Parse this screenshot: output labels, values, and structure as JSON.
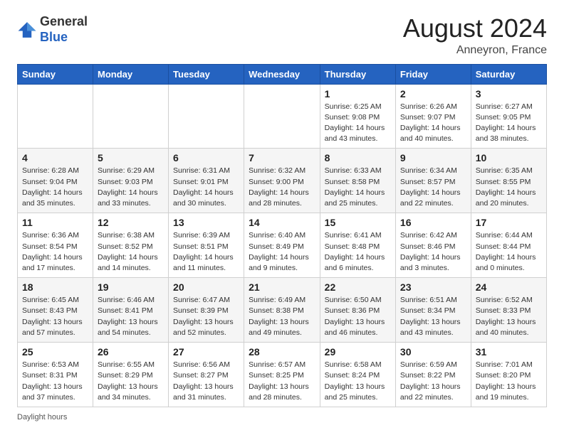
{
  "header": {
    "logo_line1": "General",
    "logo_line2": "Blue",
    "month_title": "August 2024",
    "location": "Anneyron, France"
  },
  "days_of_week": [
    "Sunday",
    "Monday",
    "Tuesday",
    "Wednesday",
    "Thursday",
    "Friday",
    "Saturday"
  ],
  "weeks": [
    [
      {
        "day": "",
        "info": ""
      },
      {
        "day": "",
        "info": ""
      },
      {
        "day": "",
        "info": ""
      },
      {
        "day": "",
        "info": ""
      },
      {
        "day": "1",
        "info": "Sunrise: 6:25 AM\nSunset: 9:08 PM\nDaylight: 14 hours and 43 minutes."
      },
      {
        "day": "2",
        "info": "Sunrise: 6:26 AM\nSunset: 9:07 PM\nDaylight: 14 hours and 40 minutes."
      },
      {
        "day": "3",
        "info": "Sunrise: 6:27 AM\nSunset: 9:05 PM\nDaylight: 14 hours and 38 minutes."
      }
    ],
    [
      {
        "day": "4",
        "info": "Sunrise: 6:28 AM\nSunset: 9:04 PM\nDaylight: 14 hours and 35 minutes."
      },
      {
        "day": "5",
        "info": "Sunrise: 6:29 AM\nSunset: 9:03 PM\nDaylight: 14 hours and 33 minutes."
      },
      {
        "day": "6",
        "info": "Sunrise: 6:31 AM\nSunset: 9:01 PM\nDaylight: 14 hours and 30 minutes."
      },
      {
        "day": "7",
        "info": "Sunrise: 6:32 AM\nSunset: 9:00 PM\nDaylight: 14 hours and 28 minutes."
      },
      {
        "day": "8",
        "info": "Sunrise: 6:33 AM\nSunset: 8:58 PM\nDaylight: 14 hours and 25 minutes."
      },
      {
        "day": "9",
        "info": "Sunrise: 6:34 AM\nSunset: 8:57 PM\nDaylight: 14 hours and 22 minutes."
      },
      {
        "day": "10",
        "info": "Sunrise: 6:35 AM\nSunset: 8:55 PM\nDaylight: 14 hours and 20 minutes."
      }
    ],
    [
      {
        "day": "11",
        "info": "Sunrise: 6:36 AM\nSunset: 8:54 PM\nDaylight: 14 hours and 17 minutes."
      },
      {
        "day": "12",
        "info": "Sunrise: 6:38 AM\nSunset: 8:52 PM\nDaylight: 14 hours and 14 minutes."
      },
      {
        "day": "13",
        "info": "Sunrise: 6:39 AM\nSunset: 8:51 PM\nDaylight: 14 hours and 11 minutes."
      },
      {
        "day": "14",
        "info": "Sunrise: 6:40 AM\nSunset: 8:49 PM\nDaylight: 14 hours and 9 minutes."
      },
      {
        "day": "15",
        "info": "Sunrise: 6:41 AM\nSunset: 8:48 PM\nDaylight: 14 hours and 6 minutes."
      },
      {
        "day": "16",
        "info": "Sunrise: 6:42 AM\nSunset: 8:46 PM\nDaylight: 14 hours and 3 minutes."
      },
      {
        "day": "17",
        "info": "Sunrise: 6:44 AM\nSunset: 8:44 PM\nDaylight: 14 hours and 0 minutes."
      }
    ],
    [
      {
        "day": "18",
        "info": "Sunrise: 6:45 AM\nSunset: 8:43 PM\nDaylight: 13 hours and 57 minutes."
      },
      {
        "day": "19",
        "info": "Sunrise: 6:46 AM\nSunset: 8:41 PM\nDaylight: 13 hours and 54 minutes."
      },
      {
        "day": "20",
        "info": "Sunrise: 6:47 AM\nSunset: 8:39 PM\nDaylight: 13 hours and 52 minutes."
      },
      {
        "day": "21",
        "info": "Sunrise: 6:49 AM\nSunset: 8:38 PM\nDaylight: 13 hours and 49 minutes."
      },
      {
        "day": "22",
        "info": "Sunrise: 6:50 AM\nSunset: 8:36 PM\nDaylight: 13 hours and 46 minutes."
      },
      {
        "day": "23",
        "info": "Sunrise: 6:51 AM\nSunset: 8:34 PM\nDaylight: 13 hours and 43 minutes."
      },
      {
        "day": "24",
        "info": "Sunrise: 6:52 AM\nSunset: 8:33 PM\nDaylight: 13 hours and 40 minutes."
      }
    ],
    [
      {
        "day": "25",
        "info": "Sunrise: 6:53 AM\nSunset: 8:31 PM\nDaylight: 13 hours and 37 minutes."
      },
      {
        "day": "26",
        "info": "Sunrise: 6:55 AM\nSunset: 8:29 PM\nDaylight: 13 hours and 34 minutes."
      },
      {
        "day": "27",
        "info": "Sunrise: 6:56 AM\nSunset: 8:27 PM\nDaylight: 13 hours and 31 minutes."
      },
      {
        "day": "28",
        "info": "Sunrise: 6:57 AM\nSunset: 8:25 PM\nDaylight: 13 hours and 28 minutes."
      },
      {
        "day": "29",
        "info": "Sunrise: 6:58 AM\nSunset: 8:24 PM\nDaylight: 13 hours and 25 minutes."
      },
      {
        "day": "30",
        "info": "Sunrise: 6:59 AM\nSunset: 8:22 PM\nDaylight: 13 hours and 22 minutes."
      },
      {
        "day": "31",
        "info": "Sunrise: 7:01 AM\nSunset: 8:20 PM\nDaylight: 13 hours and 19 minutes."
      }
    ]
  ],
  "footer": {
    "label": "Daylight hours"
  }
}
